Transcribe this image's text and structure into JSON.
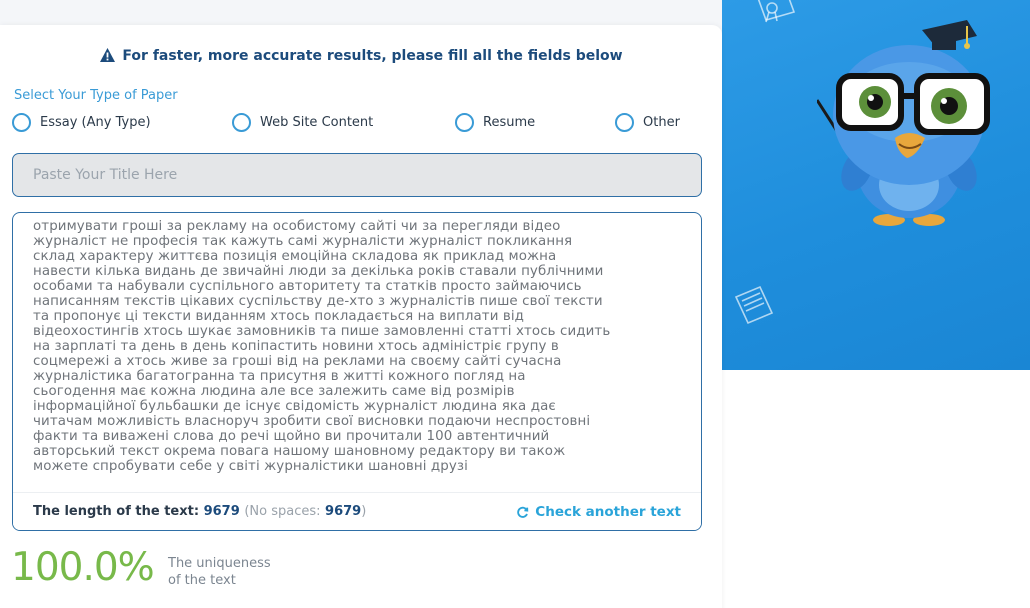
{
  "notice": {
    "text": "For faster, more accurate results, please fill all the fields below",
    "icon": "warning-icon"
  },
  "paper_type": {
    "label": "Select Your Type of Paper",
    "options": [
      "Essay (Any Type)",
      "Web Site Content",
      "Resume",
      "Other"
    ]
  },
  "title_input": {
    "placeholder": "Paste Your Title Here",
    "value": ""
  },
  "text_area": {
    "lines": [
      "отримувати гроші за рекламу на особистому сайті чи за перегляди відео",
      "журналіст не професія так кажуть самі журналісти журналіст покликання",
      "склад характеру життєва позиція емоційна складова як приклад можна",
      "навести кілька видань де звичайні люди за декілька років ставали публічними",
      "особами та набували суспільного авторитету та статків просто займаючись",
      "написанням текстів цікавих суспільству де-хто з журналістів пише свої тексти",
      "та пропонує ці тексти виданням хтось покладається на виплати від",
      "відеохостингів хтось шукає замовників та пише замовленні статті хтось сидить",
      "на зарплаті та день в день копіпастить новини хтось адміністріє групу в",
      "соцмережі а хтось живе за гроші від на реклами на своєму сайті сучасна",
      "журналістика багатогранна та присутня в житті кожного погляд на",
      "сьогодення має кожна людина але все залежить саме від розмірів",
      "інформаційної бульбашки де існує свідомість журналіст людина яка дає",
      "читачам можливість власноруч зробити свої висновки подаючи неспростовні",
      "факти та виважені слова до речі щойно ви прочитали 100 автентичний",
      "авторський текст окрема повага нашому шановному редактору ви також",
      "можете спробувати себе у світі журналістики шановні друзі"
    ]
  },
  "stats": {
    "length_label": "The length of the text:",
    "length_value": "9679",
    "no_spaces_label": "No spaces:",
    "no_spaces_value": "9679",
    "check_another": "Check another text",
    "check_icon": "refresh-icon"
  },
  "uniqueness": {
    "percent": "100.0%",
    "label_line1": "The uniqueness",
    "label_line2": "of the text"
  },
  "colors": {
    "accent_blue": "#2aa4d9",
    "navy": "#1c4b7c",
    "success_green": "#78b94a",
    "panel_blue": "#1f8edc"
  }
}
